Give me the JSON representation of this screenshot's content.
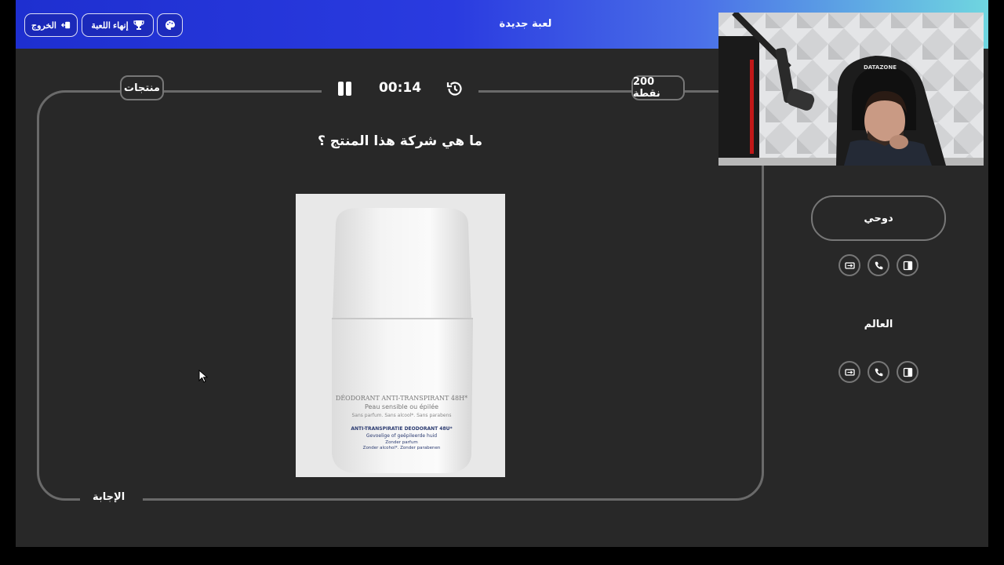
{
  "header": {
    "title": "لعبة جديدة",
    "end_game_label": "إنهاء اللعبة",
    "exit_label": "الخروج"
  },
  "round": {
    "category": "منتجات",
    "points": "200 نقطة",
    "timer": "00:14",
    "question": "ما هي شركة هذا المنتج ؟",
    "answer_label": "الإجابة"
  },
  "product": {
    "line1": "DÉODORANT ANTI-TRANSPIRANT 48H*",
    "line2": "Peau sensible ou épilée",
    "line3": "Sans parfum. Sans alcool*. Sans parabens",
    "line4": "ANTI-TRANSPIRATIE DEODORANT 48U*",
    "line5": "Gevoelige of geëpileerde huid",
    "line6": "Zonder parfum",
    "line7": "Zonder alcohol*. Zonder parabenen"
  },
  "teams": [
    {
      "name": "دوحي"
    },
    {
      "name": "العالم"
    }
  ],
  "webcam": {
    "chair_brand": "DATAZONE"
  },
  "colors": {
    "accent_blue": "#2a3be0",
    "stage_bg": "#282828",
    "frame_border": "#6a6a6a"
  }
}
